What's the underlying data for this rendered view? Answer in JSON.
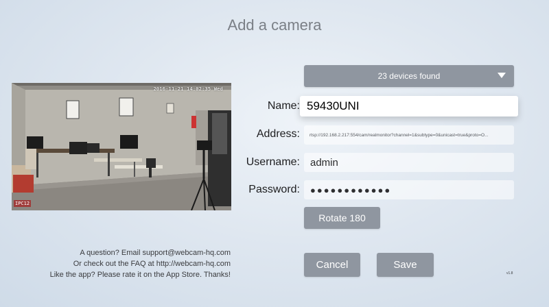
{
  "title": "Add a camera",
  "devices": {
    "label": "23 devices found",
    "icon": "chevron-down-icon"
  },
  "preview": {
    "timestamp": "2016-11-21 14:02:35 Wed",
    "camera_label": "IPC12"
  },
  "form": {
    "name_label": "Name:",
    "name_value": "59430UNI",
    "address_label": "Address:",
    "address_value": "rtsp://192.168.2.217:554/cam/realmonitor?channel=1&subtype=0&unicast=true&proto=O...",
    "username_label": "Username:",
    "username_value": "admin",
    "password_label": "Password:",
    "password_value": "●●●●●●●●●●●●"
  },
  "buttons": {
    "rotate": "Rotate 180",
    "cancel": "Cancel",
    "save": "Save"
  },
  "help": {
    "line1": "A question? Email support@webcam-hq.com",
    "line2": "Or check out the FAQ at http://webcam-hq.com",
    "line3": "Like the app? Please rate it on the App Store. Thanks!"
  },
  "version": "v1.8"
}
